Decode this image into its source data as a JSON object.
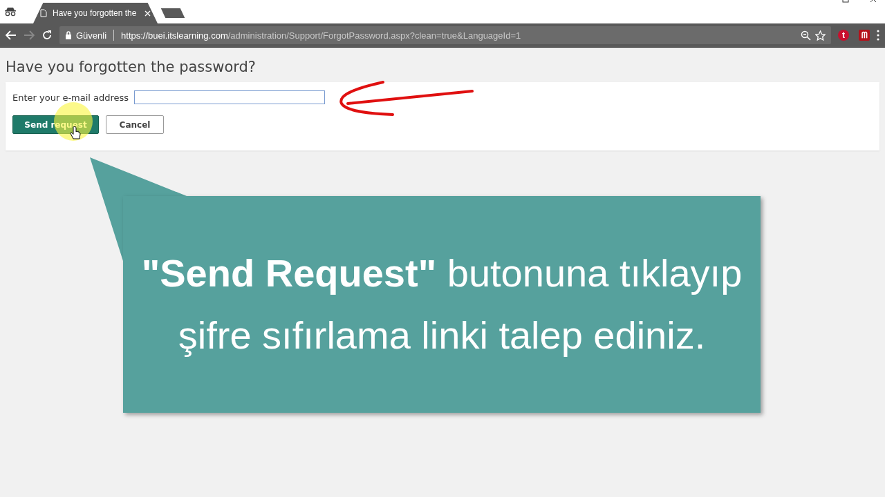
{
  "browser": {
    "tab_title": "Have you forgotten the",
    "security_label": "Güvenli",
    "url_host": "https://buei.itslearning.com",
    "url_path": "/administration/Support/ForgotPassword.aspx?clean=true&LanguageId=1",
    "extensions": [
      {
        "label": "t",
        "color": "#c8102e"
      },
      {
        "label": "ᗰ",
        "color": "#b5121b"
      }
    ]
  },
  "page": {
    "heading": "Have you forgotten the password?",
    "email_label": "Enter your e-mail address",
    "buttons": [
      {
        "label": "Send request",
        "kind": "primary"
      },
      {
        "label": "Cancel",
        "kind": "secondary"
      }
    ]
  },
  "callout": {
    "text": "**\"Send Request\"** butonuna tıklayıp şifre sıfırlama linki talep ediniz."
  }
}
